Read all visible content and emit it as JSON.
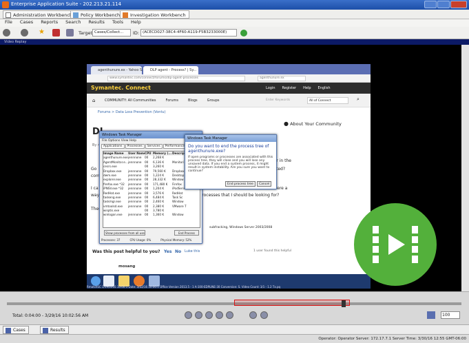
{
  "window": {
    "title": "Enterprise Application Suite - 202.213.21.114"
  },
  "app_tabs": [
    {
      "label": "Administration Workbench"
    },
    {
      "label": "Policy Workbench"
    },
    {
      "label": "Investigation Workbench"
    }
  ],
  "menu": [
    "File",
    "Cases",
    "Reports",
    "Search",
    "Results",
    "Tools",
    "Help"
  ],
  "toolbar": {
    "target_label": "Target:",
    "target_value": "Cases/Collect...",
    "id_label": "ID:",
    "id_value": "(ACECD027-38C4-4F60-A119-F5B3233000E)"
  },
  "player_bar": {
    "title": "Video Replay"
  },
  "browser": {
    "tab1": "agenthunure.ex - Yahoo S...",
    "tab2": "DLP agent - Process? | Sy...",
    "url": "www.symantec.com/connect/forums/dlp-agent-processes",
    "search": "agenthunure.ex",
    "brand": "Symantec. Connect",
    "header_links": [
      "Login",
      "Register",
      "Help",
      "English"
    ],
    "nav": [
      "COMMUNITY: All Communities",
      "Forums",
      "Blogs",
      "Groups"
    ],
    "search_placeholder": "Enter Keywords",
    "search_scope": "All of Connect",
    "breadcrumb": "Forums > Data Loss Prevention (Vontu)",
    "heading": "DL",
    "about": "About Your Community",
    "body_fragments": [
      "By m",
      "Go",
      "comp",
      "I ca",
      "way",
      "Thes",
      "more processes that I should be looking for?",
      "ear in the",
      "ected?",
      "there a"
    ],
    "link_text": "subfracking, Windows Server 2003/2008",
    "helpful": "Was this post helpful to you?",
    "yes": "Yes",
    "no": "No",
    "helpful_link": "Luke this",
    "found_helpful": "1 user found this helpful",
    "username": "mosang"
  },
  "task_manager": {
    "title": "Windows Task Manager",
    "menu": "File  Options  View  Help",
    "tabs": [
      "Applications",
      "Processes",
      "Services",
      "Performance",
      "Networking"
    ],
    "columns": [
      "Image Name",
      "User Name",
      "CPU",
      "Memory (...",
      "Descript"
    ],
    "rows": [
      [
        "agenthunure.exe",
        "jennnone",
        "00",
        "2,268 K",
        ""
      ],
      [
        "AgentMonitor.e...",
        "jennnone",
        "00",
        "6,136 K",
        "Monitori"
      ],
      [
        "cesrs.exe",
        "",
        "00",
        "3,260 K",
        ""
      ],
      [
        "Dropbox.exe",
        "jennnone",
        "00",
        "79,560 K",
        "Dropbox"
      ],
      [
        "dwm.exe",
        "jennnone",
        "00",
        "1,224 K",
        "Desktop"
      ],
      [
        "explorer.exe",
        "jennnone",
        "00",
        "28,332 K",
        "Window"
      ],
      [
        "firefox.exe *32",
        "jennnone",
        "00",
        "171,480 K",
        "Firefox"
      ],
      [
        "iPNSV.exe *32",
        "jennnone",
        "00",
        "1,204 K",
        "iPodServ"
      ],
      [
        "RedHat.exe",
        "jennnone",
        "00",
        "3,576 K",
        "RedHat"
      ],
      [
        "taskeng.exe",
        "jennnone",
        "00",
        "6,484 K",
        "Task Sc"
      ],
      [
        "taskmgr.exe",
        "jennnone",
        "00",
        "2,460 K",
        "Window"
      ],
      [
        "vmtoolsd.exe",
        "jennnone",
        "00",
        "2,380 K",
        "VMware T"
      ],
      [
        "wisptis.exe",
        "",
        "00",
        "3,780 K",
        ""
      ],
      [
        "winlogon.exe",
        "jennnone",
        "00",
        "1,360 K",
        "Window"
      ]
    ],
    "show_all": "Show processes from all users",
    "end_process": "End Process",
    "footer": [
      "Processes: 37",
      "CPU Usage: 0%",
      "Physical Memory: 52%"
    ]
  },
  "dialog": {
    "title": "Windows Task Manager",
    "question": "Do you want to end the process tree of agenthunure.exe?",
    "message": "If open programs or processes are associated with this process tree, they will close and you will lose any unsaved data. If you end a system process, it might result in system instability. Are you sure you want to continue?",
    "confirm": "End process tree",
    "cancel": "Cancel"
  },
  "video_status": "RmatchSC 1/19/2016 10:00:1 Date: 3/22/16 10:00:1 Office Version 2013.5 - 1 A-100-EDPLINE-30 Conversion: S. Video Count: 3/1 - 1.2 Tx.pq",
  "controls": {
    "total": "Total: 0:04:00 - 3/29/16 10:02:56 AM",
    "zoom": "100"
  },
  "bottom_tabs": [
    "Cases",
    "Results"
  ],
  "status_bar": "Operator: Operator   Server: 172.17.7.1   Server Time: 3/30/16 12:55 GMT-06:00",
  "colors": {
    "accent": "#53b03b",
    "brand_blue": "#1d4fa8"
  }
}
